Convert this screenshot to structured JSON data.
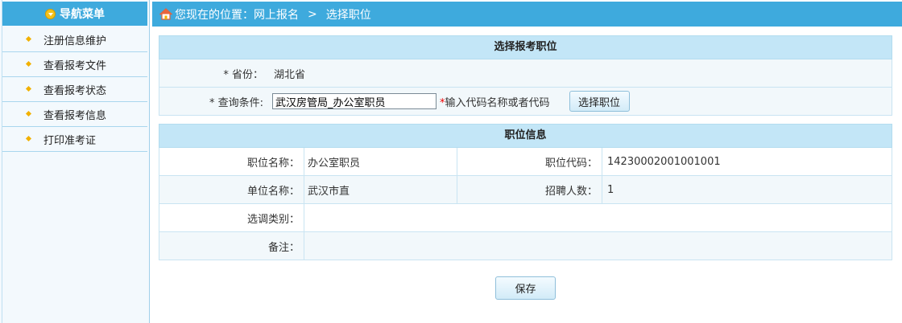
{
  "sidebar": {
    "title": "导航菜单",
    "items": [
      {
        "label": "注册信息维护"
      },
      {
        "label": "查看报考文件"
      },
      {
        "label": "查看报考状态"
      },
      {
        "label": "查看报考信息"
      },
      {
        "label": "打印准考证"
      }
    ]
  },
  "breadcrumb": {
    "prefix": "您现在的位置：",
    "path1": "网上报名",
    "separator": ">",
    "path2": "选择职位"
  },
  "select_section": {
    "title": "选择报考职位",
    "province_label": "* 省份：",
    "province_value": "湖北省",
    "query_label": "* 查询条件:",
    "query_value": "武汉房管局_办公室职员",
    "hint_star": "*",
    "hint_text": "输入代码名称或者代码",
    "select_button": "选择职位"
  },
  "info_section": {
    "title": "职位信息",
    "position_name_label": "职位名称：",
    "position_name_value": "办公室职员",
    "position_code_label": "职位代码：",
    "position_code_value": "14230002001001001",
    "unit_name_label": "单位名称：",
    "unit_name_value": "武汉市直",
    "recruit_count_label": "招聘人数：",
    "recruit_count_value": "1",
    "transfer_type_label": "选调类别：",
    "transfer_type_value": "",
    "remarks_label": "备注：",
    "remarks_value": ""
  },
  "save_button": "保存",
  "colors": {
    "header_blue": "#3eaadd",
    "section_blue": "#c3e6f7",
    "accent_yellow": "#f2b100"
  }
}
